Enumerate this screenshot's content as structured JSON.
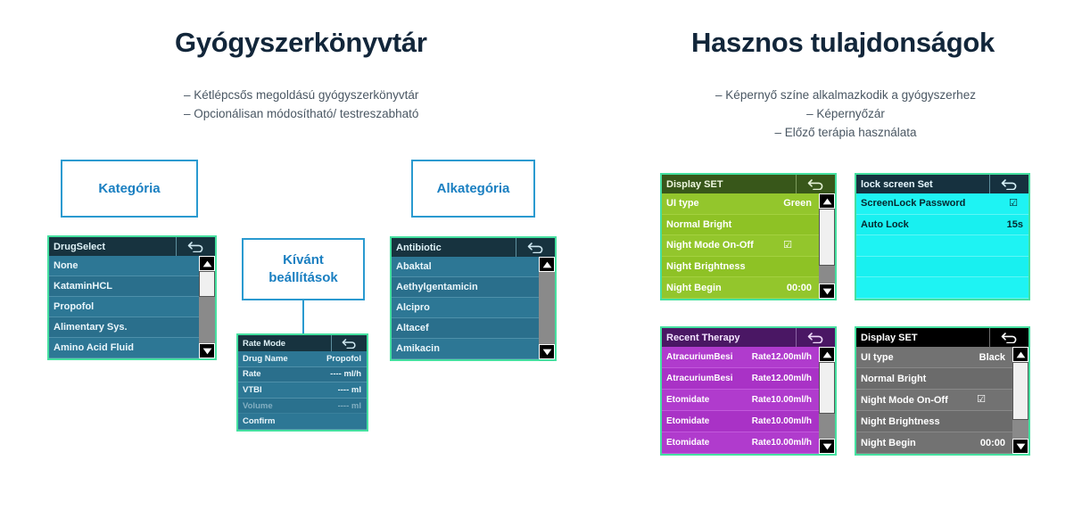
{
  "sections": {
    "left": {
      "title": "Gyógyszerkönyvtár",
      "bullets": [
        "– Kétlépcsős megoldású gyógyszerkönyvtár",
        "– Opcionálisan módosítható/ testreszabható"
      ]
    },
    "right": {
      "title": "Hasznos tulajdonságok",
      "bullets": [
        "– Képernyő színe alkalmazkodik a gyógyszerhez",
        "– Képernyőzár",
        "– Előző terápia használata"
      ]
    }
  },
  "callouts": {
    "category": "Kategória",
    "subcategory": "Alkategória",
    "settings_line1": "Kívánt",
    "settings_line2": "beállítások"
  },
  "icons": {
    "back": "back-arrow-icon",
    "scroll_up": "scroll-up-arrow-icon",
    "scroll_down": "scroll-down-arrow-icon",
    "checkbox_checked": "☑"
  },
  "colors": {
    "accent_blue": "#2a9ad0",
    "heading": "#12263a",
    "panel_border": "#45e0a0",
    "theme_teal": "#2b7391",
    "theme_green": "#8cc022",
    "theme_cyan": "#17efef",
    "theme_purple": "#ab35c9",
    "theme_black": "#6d6d6d"
  },
  "panels": {
    "drugselect": {
      "title": "DrugSelect",
      "rows": [
        {
          "label": "None",
          "value": "",
          "radio": "on"
        },
        {
          "label": "KataminHCL",
          "value": "",
          "radio": "off"
        },
        {
          "label": "Propofol",
          "value": "",
          "radio": "off"
        },
        {
          "label": "Alimentary Sys.",
          "value": "",
          "radio": ""
        },
        {
          "label": "Amino Acid Fluid",
          "value": "",
          "radio": ""
        }
      ]
    },
    "ratemode": {
      "title": "Rate Mode",
      "rows": [
        {
          "label": "Drug Name",
          "value": "Propofol"
        },
        {
          "label": "Rate",
          "value": "---- ml/h"
        },
        {
          "label": "VTBI",
          "value": "---- ml"
        },
        {
          "label": "Volume",
          "value": "---- ml",
          "dim": true
        },
        {
          "label": "Confirm",
          "value": ""
        }
      ]
    },
    "antibiotic": {
      "title": "Antibiotic",
      "rows": [
        {
          "label": "Abaktal",
          "value": "",
          "radio": "off"
        },
        {
          "label": "Aethylgentamicin",
          "value": "",
          "radio": "off"
        },
        {
          "label": "Alcipro",
          "value": "",
          "radio": "off"
        },
        {
          "label": "Altacef",
          "value": "",
          "radio": "off"
        },
        {
          "label": "Amikacin",
          "value": "",
          "radio": "off"
        }
      ]
    },
    "display_green": {
      "title": "Display SET",
      "rows": [
        {
          "label": "UI type",
          "value": "Green"
        },
        {
          "label": "Normal Bright",
          "value": ""
        },
        {
          "label": "Night Mode On-Off",
          "value": "☑"
        },
        {
          "label": "Night Brightness",
          "value": ""
        },
        {
          "label": "Night Begin",
          "value": "00:00"
        }
      ]
    },
    "lockscreen": {
      "title": "lock screen Set",
      "rows": [
        {
          "label": "ScreenLock Password",
          "value": "☑"
        },
        {
          "label": "Auto Lock",
          "value": "15s"
        },
        {
          "label": "",
          "value": ""
        },
        {
          "label": "",
          "value": ""
        },
        {
          "label": "",
          "value": ""
        }
      ]
    },
    "recent_therapy": {
      "title": "Recent Therapy",
      "rows": [
        {
          "label": "AtracuriumBesi",
          "value": "Rate12.00ml/h"
        },
        {
          "label": "AtracuriumBesi",
          "value": "Rate12.00ml/h"
        },
        {
          "label": "Etomidate",
          "value": "Rate10.00ml/h"
        },
        {
          "label": "Etomidate",
          "value": "Rate10.00ml/h"
        },
        {
          "label": "Etomidate",
          "value": "Rate10.00ml/h"
        }
      ]
    },
    "display_black": {
      "title": "Display SET",
      "rows": [
        {
          "label": "UI type",
          "value": "Black"
        },
        {
          "label": "Normal Bright",
          "value": ""
        },
        {
          "label": "Night Mode On-Off",
          "value": "☑"
        },
        {
          "label": "Night Brightness",
          "value": ""
        },
        {
          "label": "Night Begin",
          "value": "00:00"
        }
      ]
    }
  }
}
